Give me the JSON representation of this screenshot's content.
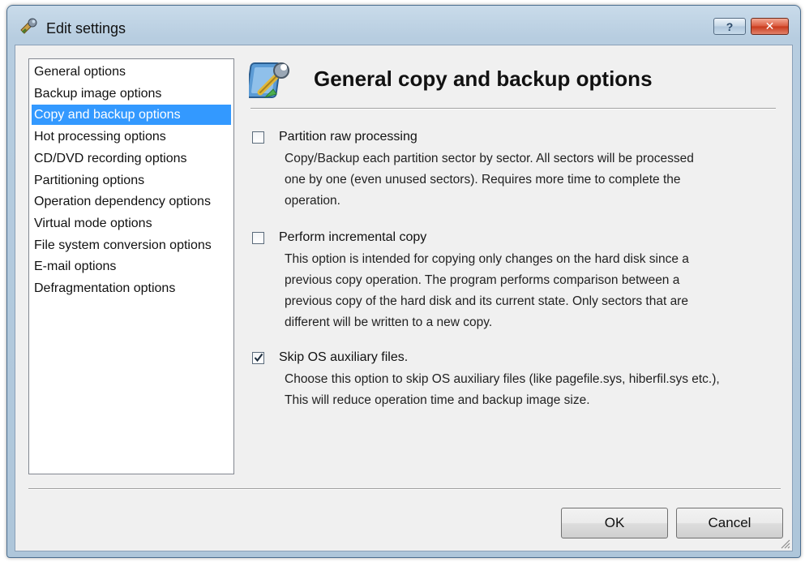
{
  "window": {
    "title": "Edit settings",
    "help_label": "?",
    "close_label": "✕"
  },
  "nav": {
    "items": [
      {
        "label": "General options",
        "selected": false
      },
      {
        "label": "Backup image options",
        "selected": false
      },
      {
        "label": "Copy and backup options",
        "selected": true
      },
      {
        "label": "Hot processing options",
        "selected": false
      },
      {
        "label": "CD/DVD recording options",
        "selected": false
      },
      {
        "label": "Partitioning options",
        "selected": false
      },
      {
        "label": "Operation dependency options",
        "selected": false
      },
      {
        "label": "Virtual mode options",
        "selected": false
      },
      {
        "label": "File system conversion options",
        "selected": false
      },
      {
        "label": "E-mail options",
        "selected": false
      },
      {
        "label": "Defragmentation options",
        "selected": false
      }
    ]
  },
  "panel": {
    "heading": "General copy and backup options",
    "header_icon": "wrench-settings-icon",
    "options": [
      {
        "label": "Partition raw processing",
        "checked": false,
        "description": [
          "Copy/Backup each partition sector by sector. All sectors will be processed",
          "one by one (even unused sectors). Requires more time to complete the",
          "operation."
        ]
      },
      {
        "label": "Perform incremental copy",
        "checked": false,
        "description": [
          "This option is intended for copying only changes on the hard disk since a",
          "previous copy operation. The program performs comparison between a",
          "previous copy of the hard disk and its current state. Only sectors that are",
          "different will be written to a new copy."
        ]
      },
      {
        "label": "Skip OS auxiliary files.",
        "checked": true,
        "description": [
          "Choose this option to skip OS auxiliary files (like pagefile.sys, hiberfil.sys etc.),",
          "This will reduce operation time and backup image size."
        ]
      }
    ]
  },
  "buttons": {
    "ok_label": "OK",
    "cancel_label": "Cancel"
  },
  "colors": {
    "selection": "#3399ff",
    "close_button": "#c8391b"
  }
}
